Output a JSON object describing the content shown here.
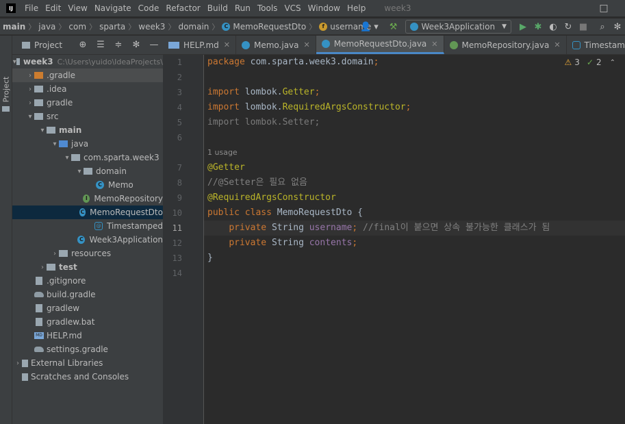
{
  "menubar": {
    "logo": "IJ",
    "items": [
      "File",
      "Edit",
      "View",
      "Navigate",
      "Code",
      "Refactor",
      "Build",
      "Run",
      "Tools",
      "VCS",
      "Window",
      "Help"
    ],
    "window_title": "week3",
    "restore_icon": "□"
  },
  "navbar": {
    "crumbs": [
      "main",
      "java",
      "com",
      "sparta",
      "week3",
      "domain",
      "MemoRequestDto",
      "username"
    ],
    "run_config": "Week3Application"
  },
  "toolstrip": {
    "label": "Project"
  },
  "project": {
    "title": "Project",
    "tree": [
      {
        "label": "week3",
        "extra": "C:\\Users\\yuido\\IdeaProjects\\",
        "icon": "folder",
        "arrow": "▾",
        "indent": 0,
        "bold": true
      },
      {
        "label": ".gradle",
        "icon": "folder-orange",
        "arrow": "›",
        "indent": 1
      },
      {
        "label": ".idea",
        "icon": "folder",
        "arrow": "›",
        "indent": 1
      },
      {
        "label": "gradle",
        "icon": "folder",
        "arrow": "›",
        "indent": 1
      },
      {
        "label": "src",
        "icon": "folder",
        "arrow": "▾",
        "indent": 1
      },
      {
        "label": "main",
        "icon": "folder",
        "arrow": "▾",
        "indent": 2,
        "bold": true
      },
      {
        "label": "java",
        "icon": "folder-blue",
        "arrow": "▾",
        "indent": 3
      },
      {
        "label": "com.sparta.week3",
        "icon": "folder",
        "arrow": "▾",
        "indent": 4
      },
      {
        "label": "domain",
        "icon": "folder",
        "arrow": "▾",
        "indent": 5
      },
      {
        "label": "Memo",
        "icon": "cls",
        "arrow": "",
        "indent": 6
      },
      {
        "label": "MemoRepository",
        "icon": "intf",
        "arrow": "",
        "indent": 6
      },
      {
        "label": "MemoRequestDto",
        "icon": "cls",
        "arrow": "",
        "indent": 6,
        "selected": true
      },
      {
        "label": "Timestamped",
        "icon": "anno",
        "arrow": "",
        "indent": 6
      },
      {
        "label": "Week3Application",
        "icon": "cls",
        "arrow": "",
        "indent": 5
      },
      {
        "label": "resources",
        "icon": "folder",
        "arrow": "›",
        "indent": 3
      },
      {
        "label": "test",
        "icon": "folder",
        "arrow": "›",
        "indent": 2,
        "bold": true
      },
      {
        "label": ".gitignore",
        "icon": "file",
        "arrow": "",
        "indent": 1
      },
      {
        "label": "build.gradle",
        "icon": "gradle",
        "arrow": "",
        "indent": 1
      },
      {
        "label": "gradlew",
        "icon": "file",
        "arrow": "",
        "indent": 1
      },
      {
        "label": "gradlew.bat",
        "icon": "file",
        "arrow": "",
        "indent": 1
      },
      {
        "label": "HELP.md",
        "icon": "md",
        "arrow": "",
        "indent": 1
      },
      {
        "label": "settings.gradle",
        "icon": "gradle",
        "arrow": "",
        "indent": 1
      },
      {
        "label": "External Libraries",
        "icon": "lib",
        "arrow": "›",
        "indent": 0
      },
      {
        "label": "Scratches and Consoles",
        "icon": "lib",
        "arrow": "",
        "indent": 0
      }
    ]
  },
  "tabs": [
    {
      "label": "HELP.md",
      "icon": "md"
    },
    {
      "label": "Memo.java",
      "icon": "cls"
    },
    {
      "label": "MemoRequestDto.java",
      "icon": "cls",
      "active": true
    },
    {
      "label": "MemoRepository.java",
      "icon": "intf"
    },
    {
      "label": "Timestampe",
      "icon": "anno"
    }
  ],
  "editor": {
    "inspections": {
      "warnings": "3",
      "checks": "2"
    },
    "usage_hint": "1 usage",
    "current_line": "11",
    "lines": [
      {
        "n": "1",
        "tokens": [
          [
            "kw",
            "package "
          ],
          [
            "pk",
            "com.sparta.week3.domain"
          ],
          [
            "kw",
            ";"
          ]
        ]
      },
      {
        "n": "2",
        "tokens": []
      },
      {
        "n": "3",
        "tokens": [
          [
            "kw",
            "import "
          ],
          [
            "pk",
            "lombok."
          ],
          [
            "an",
            "Getter"
          ],
          [
            "kw",
            ";"
          ]
        ]
      },
      {
        "n": "4",
        "tokens": [
          [
            "kw",
            "import "
          ],
          [
            "pk",
            "lombok."
          ],
          [
            "an",
            "RequiredArgsConstructor"
          ],
          [
            "kw",
            ";"
          ]
        ]
      },
      {
        "n": "5",
        "tokens": [
          [
            "dim",
            "import lombok.Setter;"
          ]
        ]
      },
      {
        "n": "6",
        "tokens": []
      },
      {
        "n": "7",
        "tokens": [
          [
            "an",
            "@Getter"
          ]
        ]
      },
      {
        "n": "8",
        "tokens": [
          [
            "cmt",
            "//@Setter"
          ],
          [
            "cmt",
            "은 필요 없음"
          ]
        ]
      },
      {
        "n": "9",
        "tokens": [
          [
            "an",
            "@RequiredArgsConstructor"
          ]
        ]
      },
      {
        "n": "10",
        "tokens": [
          [
            "kw",
            "public class "
          ],
          [
            "cls",
            "MemoRequestDto "
          ],
          [
            "pk",
            "{"
          ]
        ]
      },
      {
        "n": "11",
        "tokens": [
          [
            "pk",
            "    "
          ],
          [
            "kw",
            "private "
          ],
          [
            "cls",
            "String "
          ],
          [
            "fld",
            "username"
          ],
          [
            "kw",
            "; "
          ],
          [
            "cmt",
            "//final이 붙으면 상속 불가능한 클래스가 됨"
          ]
        ]
      },
      {
        "n": "12",
        "tokens": [
          [
            "pk",
            "    "
          ],
          [
            "kw",
            "private "
          ],
          [
            "cls",
            "String "
          ],
          [
            "fld",
            "contents"
          ],
          [
            "kw",
            ";"
          ]
        ]
      },
      {
        "n": "13",
        "tokens": [
          [
            "pk",
            "}"
          ]
        ]
      },
      {
        "n": "14",
        "tokens": []
      }
    ]
  }
}
